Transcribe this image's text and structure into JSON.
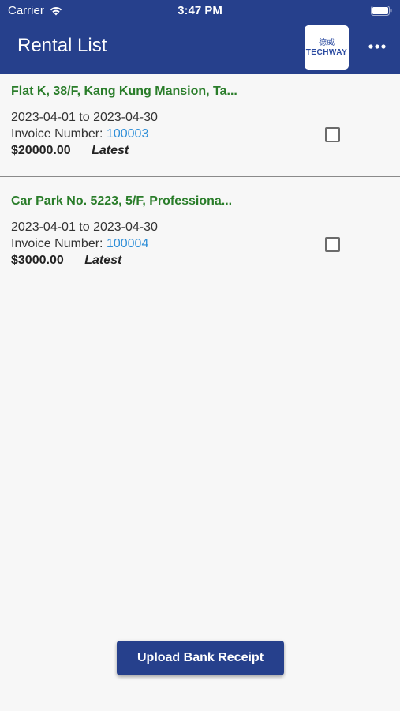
{
  "status_bar": {
    "carrier": "Carrier",
    "time": "3:47 PM",
    "wifi_icon": "wifi-icon",
    "battery_icon": "battery-icon"
  },
  "header": {
    "title": "Rental List",
    "logo_text_cn": "德威",
    "logo_text": "TECHWAY",
    "more_icon": "more-horizontal-icon",
    "background_color": "#26408c"
  },
  "rentals": [
    {
      "property": "Flat K, 38/F, Kang Kung Mansion, Ta...",
      "period": "2023-04-01 to 2023-04-30",
      "invoice_label": "Invoice Number:",
      "invoice_number": "100003",
      "amount": "$20000.00",
      "status": "Latest",
      "checked": false
    },
    {
      "property": "Car Park No. 5223, 5/F, Professiona...",
      "period": "2023-04-01 to 2023-04-30",
      "invoice_label": "Invoice Number:",
      "invoice_number": "100004",
      "amount": "$3000.00",
      "status": "Latest",
      "checked": false
    }
  ],
  "actions": {
    "upload_label": "Upload Bank Receipt"
  },
  "colors": {
    "property_text": "#2a7d2a",
    "invoice_link": "#2f8fd8",
    "primary": "#26408c"
  }
}
